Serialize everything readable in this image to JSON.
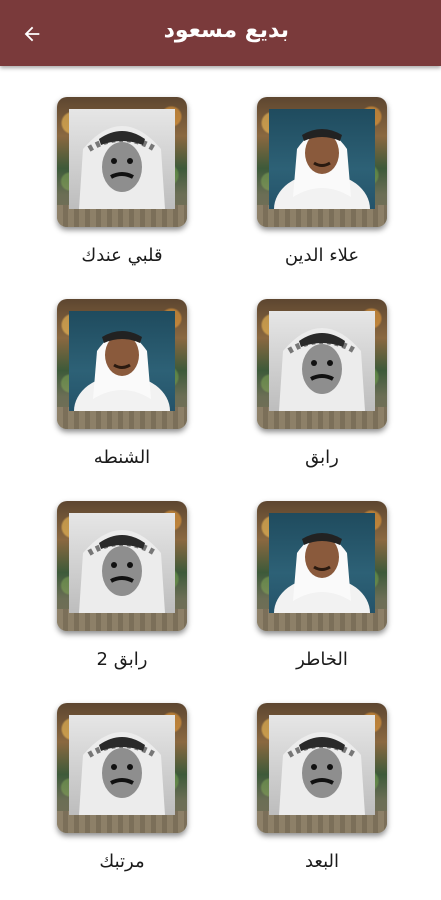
{
  "appbar": {
    "title": "بديع مسعود",
    "back_icon": "arrow-left-icon",
    "background": "#7a3a3b"
  },
  "songs": [
    {
      "title": "علاء الدين",
      "photo": "color"
    },
    {
      "title": "قلبي عندك",
      "photo": "bw"
    },
    {
      "title": "رابق",
      "photo": "bw"
    },
    {
      "title": "الشنطه",
      "photo": "color"
    },
    {
      "title": "الخاطر",
      "photo": "color"
    },
    {
      "title": "رابق 2",
      "photo": "bw"
    },
    {
      "title": "البعد",
      "photo": "bw"
    },
    {
      "title": "مرتبك",
      "photo": "bw"
    }
  ]
}
